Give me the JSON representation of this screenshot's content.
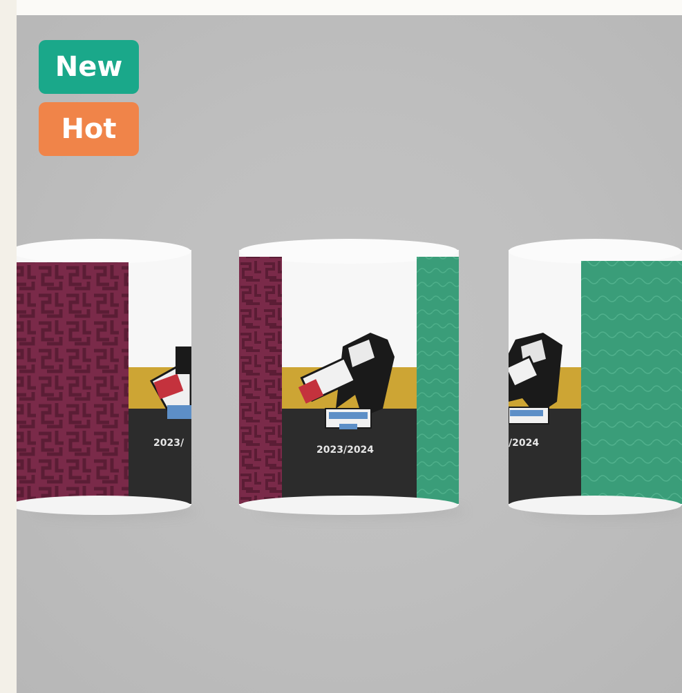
{
  "badges": {
    "new_label": "New",
    "hot_label": "Hot"
  },
  "colors": {
    "new_badge": "#1aa88a",
    "hot_badge": "#f08449",
    "mug_maroon": "#7a2a49",
    "mug_green": "#3a9d79",
    "mug_gold": "#cda534",
    "mug_dark": "#2c2c2c"
  },
  "mugs": {
    "left_year": "2023/",
    "center_year": "2023/2024",
    "right_year": "/2024"
  },
  "icons": {
    "emblem": "mascot-emblem-icon"
  }
}
